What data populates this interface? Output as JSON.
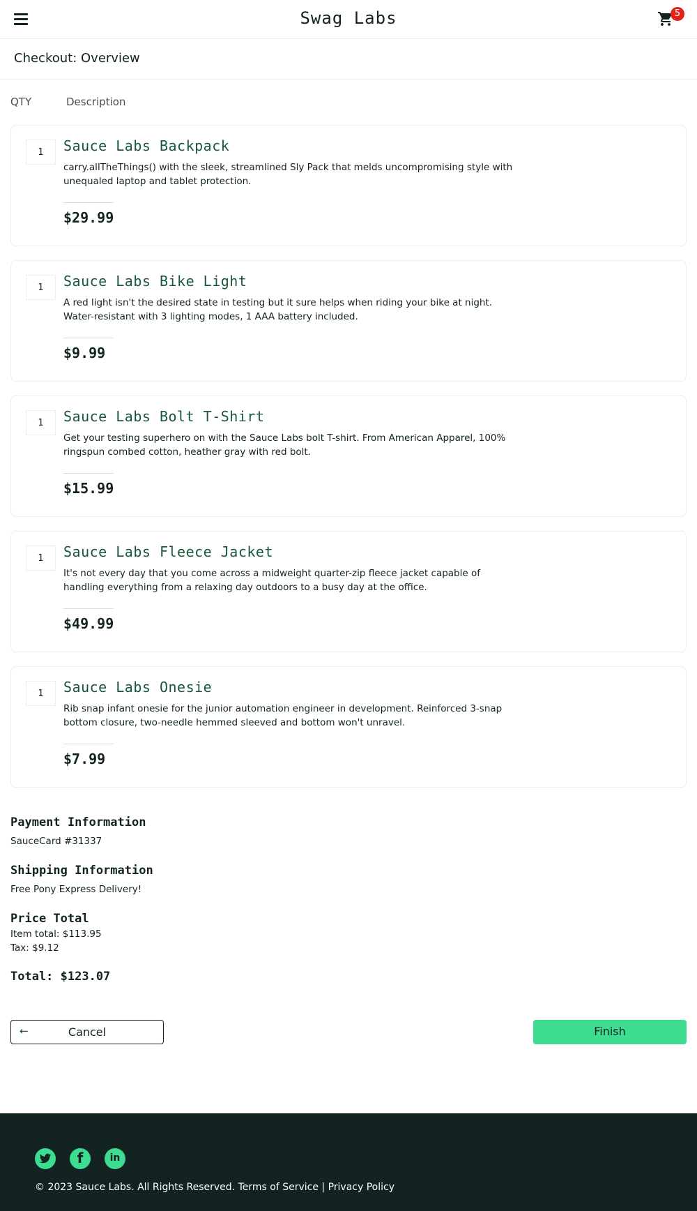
{
  "header": {
    "app_title": "Swag Labs",
    "cart_count": "5"
  },
  "page": {
    "title": "Checkout: Overview"
  },
  "columns": {
    "qty": "QTY",
    "description": "Description"
  },
  "items": [
    {
      "qty": "1",
      "name": "Sauce Labs Backpack",
      "description": "carry.allTheThings() with the sleek, streamlined Sly Pack that melds uncompromising style with unequaled laptop and tablet protection.",
      "price": "$29.99"
    },
    {
      "qty": "1",
      "name": "Sauce Labs Bike Light",
      "description": "A red light isn't the desired state in testing but it sure helps when riding your bike at night. Water-resistant with 3 lighting modes, 1 AAA battery included.",
      "price": "$9.99"
    },
    {
      "qty": "1",
      "name": "Sauce Labs Bolt T-Shirt",
      "description": "Get your testing superhero on with the Sauce Labs bolt T-shirt. From American Apparel, 100% ringspun combed cotton, heather gray with red bolt.",
      "price": "$15.99"
    },
    {
      "qty": "1",
      "name": "Sauce Labs Fleece Jacket",
      "description": "It's not every day that you come across a midweight quarter-zip fleece jacket capable of handling everything from a relaxing day outdoors to a busy day at the office.",
      "price": "$49.99"
    },
    {
      "qty": "1",
      "name": "Sauce Labs Onesie",
      "description": "Rib snap infant onesie for the junior automation engineer in development. Reinforced 3-snap bottom closure, two-needle hemmed sleeved and bottom won't unravel.",
      "price": "$7.99"
    }
  ],
  "summary": {
    "payment_label": "Payment Information",
    "payment_value": "SauceCard #31337",
    "shipping_label": "Shipping Information",
    "shipping_value": "Free Pony Express Delivery!",
    "price_label": "Price Total",
    "item_total": "Item total: $113.95",
    "tax": "Tax: $9.12",
    "total": "Total: $123.07"
  },
  "buttons": {
    "cancel": "Cancel",
    "cancel_icon": "arrow-left-icon",
    "finish": "Finish"
  },
  "footer": {
    "copyright": "© 2023 Sauce Labs. All Rights Reserved.",
    "terms": "Terms of Service",
    "separator": "|",
    "privacy": "Privacy Policy",
    "social_icons": [
      "twitter-icon",
      "facebook-icon",
      "linkedin-icon"
    ]
  },
  "colors": {
    "accent": "#3ddc91",
    "dark": "#132322",
    "product_name": "#18583a",
    "badge": "#e2231a"
  }
}
